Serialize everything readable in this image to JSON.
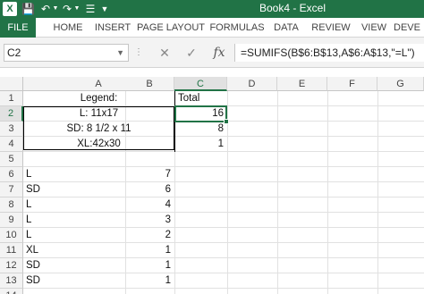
{
  "window": {
    "title": "Book4 - Excel"
  },
  "quick_access": {
    "save_icon": "save-icon",
    "undo_icon": "undo-icon",
    "redo_icon": "redo-icon",
    "touch_icon": "touch-mode-icon",
    "customize_icon": "customize-icon"
  },
  "ribbon": {
    "tabs": [
      {
        "label": "FILE"
      },
      {
        "label": "HOME"
      },
      {
        "label": "INSERT"
      },
      {
        "label": "PAGE LAYOUT"
      },
      {
        "label": "FORMULAS"
      },
      {
        "label": "DATA"
      },
      {
        "label": "REVIEW"
      },
      {
        "label": "VIEW"
      },
      {
        "label": "DEVE"
      }
    ]
  },
  "formula_bar": {
    "name_box": "C2",
    "cancel_symbol": "✕",
    "enter_symbol": "✓",
    "fx_symbol": "fx",
    "formula": "=SUMIFS(B$6:B$13,A$6:A$13,\"=L\")"
  },
  "grid": {
    "columns": [
      "A",
      "B",
      "C",
      "D",
      "E",
      "F",
      "G"
    ],
    "selected_column": "C",
    "rows": [
      "1",
      "2",
      "3",
      "4",
      "5",
      "6",
      "7",
      "8",
      "9",
      "10",
      "11",
      "12",
      "13",
      "14"
    ],
    "selected_row": "2",
    "cells": {
      "A1": "Legend:",
      "C1": "Total",
      "A2": "L: 11x17",
      "C2": "16",
      "A3": "SD: 8 1/2 x 11",
      "C3": "8",
      "A4": "XL:42x30",
      "C4": "1",
      "A6": "L",
      "B6": "7",
      "A7": "SD",
      "B7": "6",
      "A8": "L",
      "B8": "4",
      "A9": "L",
      "B9": "3",
      "A10": "L",
      "B10": "2",
      "A11": "XL",
      "B11": "1",
      "A12": "SD",
      "B12": "1",
      "A13": "SD",
      "B13": "1"
    }
  },
  "colors": {
    "accent": "#217346",
    "header_bg": "#f3f3f3",
    "gridline": "#e1e1e1"
  }
}
